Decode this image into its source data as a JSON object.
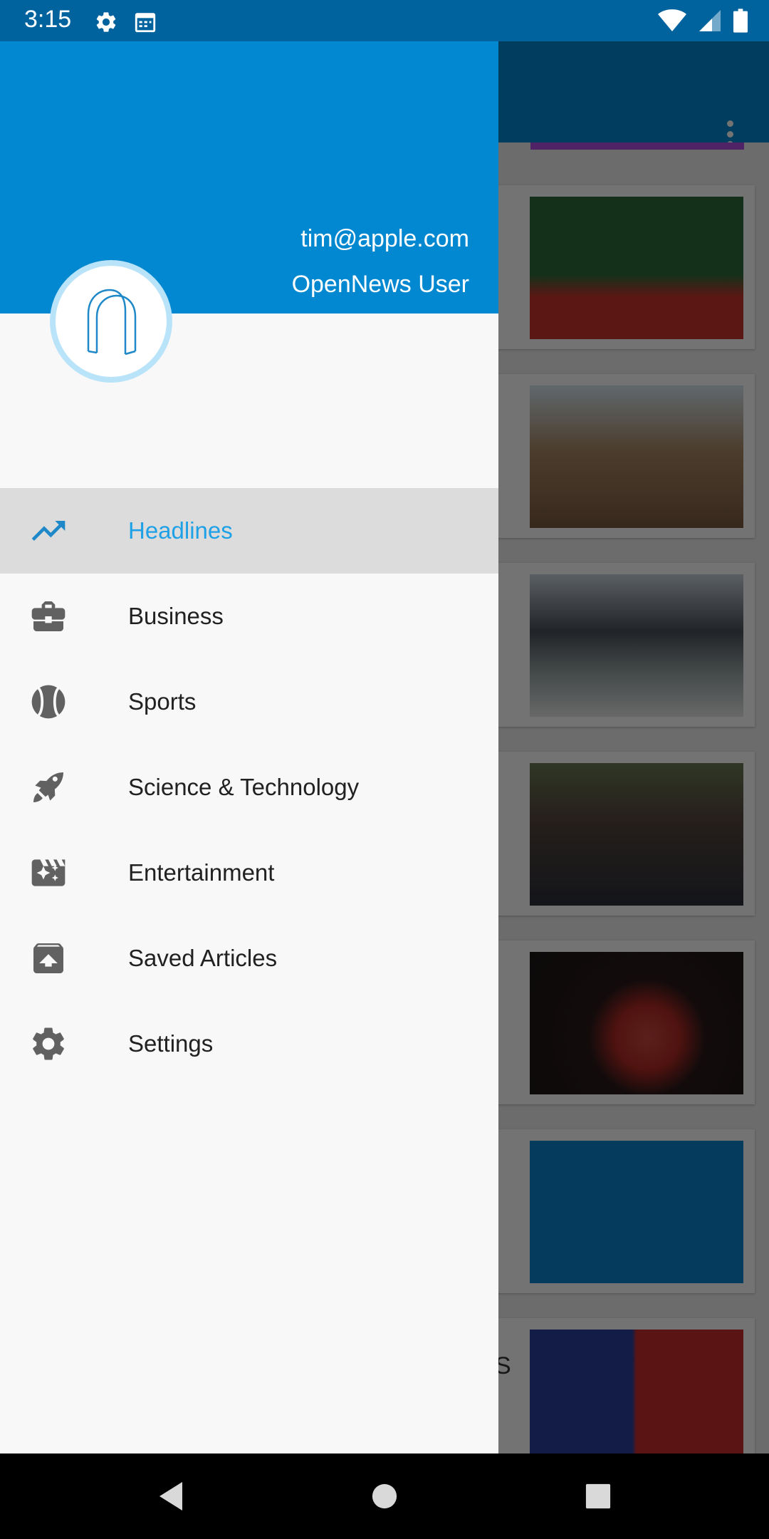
{
  "status_bar": {
    "time": "3:15",
    "left_icons": [
      "gear-icon",
      "calendar-icon"
    ],
    "right_icons": [
      "wifi-icon",
      "signal-icon",
      "battery-icon"
    ]
  },
  "drawer": {
    "account": {
      "email": "tim@apple.com",
      "name": "OpenNews User",
      "avatar_icon": "opennews-logo-icon"
    },
    "items": [
      {
        "label": "Headlines",
        "icon": "trending-up-icon",
        "selected": true
      },
      {
        "label": "Business",
        "icon": "briefcase-icon",
        "selected": false
      },
      {
        "label": "Sports",
        "icon": "tennis-ball-icon",
        "selected": false
      },
      {
        "label": "Science & Technology",
        "icon": "rocket-icon",
        "selected": false
      },
      {
        "label": "Entertainment",
        "icon": "movie-clapper-icon",
        "selected": false
      },
      {
        "label": "Saved Articles",
        "icon": "archive-box-icon",
        "selected": false
      },
      {
        "label": "Settings",
        "icon": "gear-icon",
        "selected": false
      }
    ]
  },
  "background_feed": {
    "overflow_icon": "more-vert-icon",
    "partial_text": "S",
    "thumbnails": [
      "soccer-photo",
      "construction-photo",
      "mountain-lake-photo",
      "crowd-photo",
      "soccer-header-photo",
      "blue-placeholder",
      "covid-morocco-photo"
    ]
  },
  "colors": {
    "primary": "#0288d1",
    "status_bar": "#01639e",
    "active_item_text": "#1ea1e6",
    "active_item_bg": "#dcdcdc",
    "drawer_bg": "#f8f8f8"
  },
  "navigation_bar": {
    "buttons": [
      "back-icon",
      "home-icon",
      "recents-icon"
    ]
  }
}
